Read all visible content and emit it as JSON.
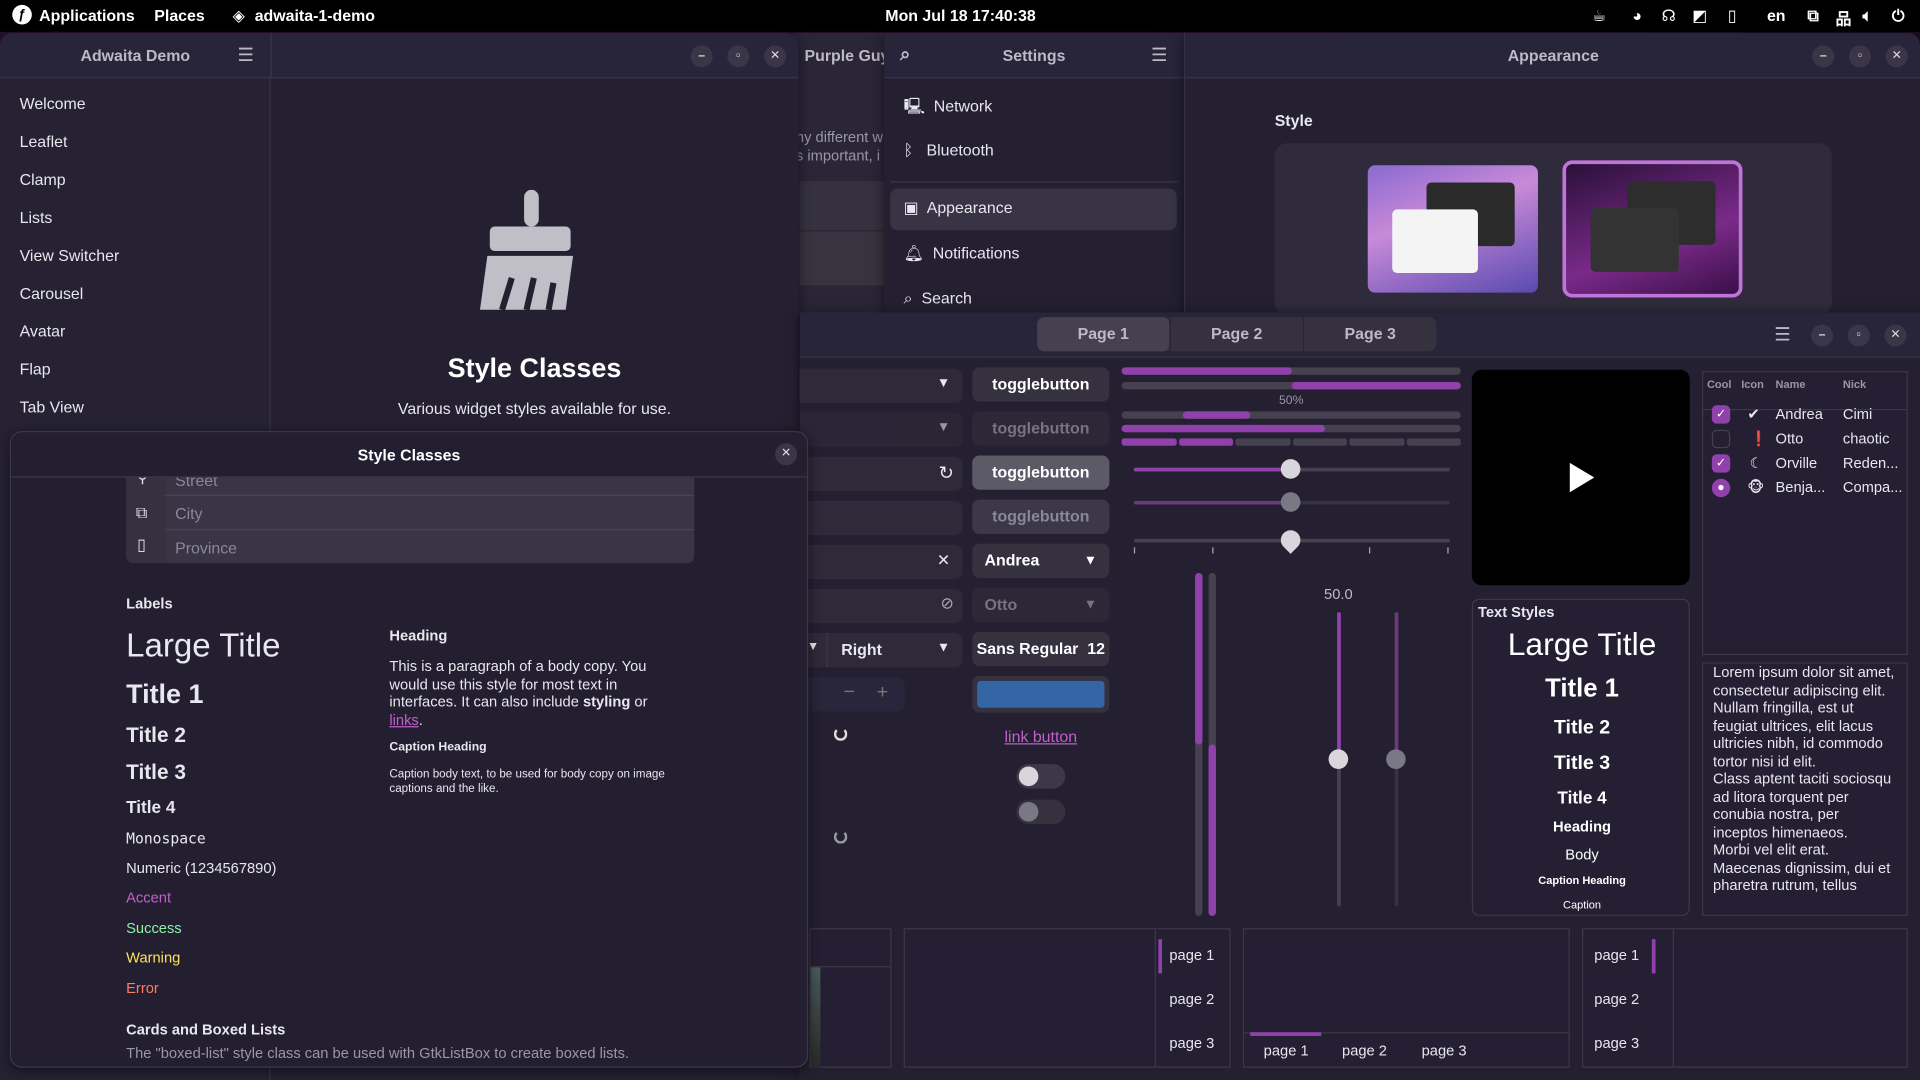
{
  "topbar": {
    "applications": "Applications",
    "places": "Places",
    "app": "adwaita-1-demo",
    "clock": "Mon Jul 18  17:40:38",
    "lang": "en",
    "tray_icons": [
      "coffee-icon",
      "steam-icon",
      "octopus-icon",
      "nvidia-icon",
      "clipboard-icon",
      "display-icon",
      "network-icon",
      "volume-icon",
      "power-icon"
    ]
  },
  "demo": {
    "title": "Adwaita Demo",
    "sidebar": [
      "Welcome",
      "Leaflet",
      "Clamp",
      "Lists",
      "View Switcher",
      "Carousel",
      "Avatar",
      "Flap",
      "Tab View"
    ],
    "page_title": "Style Classes",
    "page_subtitle": "Various widget styles available for use."
  },
  "dialog": {
    "title": "Style Classes",
    "entries": [
      "Street",
      "City",
      "Province"
    ],
    "labels_heading": "Labels",
    "labels": {
      "large_title": "Large Title",
      "title1": "Title 1",
      "title2": "Title 2",
      "title3": "Title 3",
      "title4": "Title 4",
      "monospace": "Monospace",
      "numeric": "Numeric (1234567890)",
      "accent": "Accent",
      "success": "Success",
      "warning": "Warning",
      "error": "Error"
    },
    "heading": "Heading",
    "body_1": "This is a paragraph of a body copy. You would use this style for most text in interfaces. It can also include ",
    "body_bold": "styling",
    "body_or": " or ",
    "body_link": "links",
    "body_end": ".",
    "caption_heading": "Caption Heading",
    "caption_body": "Caption body text, to be used for body copy on image captions and the like.",
    "cards_heading": "Cards and Boxed Lists",
    "cards_text": "The \"boxed-list\" style class can be used with GtkListBox to create boxed lists."
  },
  "purple": {
    "title": "Purple Guy",
    "line1": "ny different w",
    "line2": "s important, i"
  },
  "settings": {
    "title": "Settings",
    "items": [
      "Network",
      "Bluetooth",
      "Appearance",
      "Notifications",
      "Search"
    ],
    "selected": "Appearance"
  },
  "appearance": {
    "title": "Appearance",
    "style_label": "Style",
    "selected_style": "dark"
  },
  "widgets": {
    "tabs": [
      "Page 1",
      "Page 2",
      "Page 3"
    ],
    "active_tab": "Page 1",
    "togglebuttons": [
      "togglebutton",
      "togglebutton",
      "togglebutton",
      "togglebutton"
    ],
    "dropdown_andrea": "Andrea",
    "dropdown_otto": "Otto",
    "dropdown_right": "Right",
    "font_button": "Sans Regular",
    "font_size": "12",
    "color_button": "#3465a4",
    "link_button": "link button",
    "progress_label": "50%",
    "progress": [
      0.5,
      0.5,
      0.6
    ],
    "segments_filled": 2,
    "segments_total": 6,
    "sliders": [
      0.5,
      0.5,
      0.5
    ],
    "vscale_label": "50.0",
    "switches": [
      false,
      false
    ]
  },
  "table": {
    "headers": [
      "Cool",
      "Icon",
      "Name",
      "Nick"
    ],
    "rows": [
      {
        "cool": true,
        "icon": "check-circle-icon",
        "name": "Andrea",
        "nick": "Cimi"
      },
      {
        "cool": false,
        "icon": "exclamation-icon",
        "name": "Otto",
        "nick": "chaotic"
      },
      {
        "cool": true,
        "icon": "moon-icon",
        "name": "Orville",
        "nick": "Reden..."
      },
      {
        "cool": "mixed",
        "icon": "monkey-icon",
        "name": "Benja...",
        "nick": "Compa..."
      }
    ]
  },
  "text_styles": {
    "heading": "Text Styles",
    "large_title": "Large Title",
    "title1": "Title 1",
    "title2": "Title 2",
    "title3": "Title 3",
    "title4": "Title 4",
    "heading_s": "Heading",
    "body": "Body",
    "caption_heading": "Caption Heading",
    "caption": "Caption"
  },
  "lorem": "Lorem ipsum dolor sit amet, consectetur adipiscing elit.\nNullam fringilla, est ut feugiat ultrices, elit lacus ultricies nibh, id commodo tortor nisi id elit.\nClass aptent taciti sociosqu ad litora torquent per conubia nostra, per inceptos himenaeos.\nMorbi vel elit erat.\nMaecenas dignissim, dui et pharetra rutrum, tellus",
  "stack_pages": [
    "page 1",
    "page 2",
    "page 3"
  ],
  "colors": {
    "accent": "#9141ac",
    "success": "#8ff0a4",
    "warning": "#f8e45c",
    "error": "#ff7b63",
    "link": "#c061cb"
  }
}
